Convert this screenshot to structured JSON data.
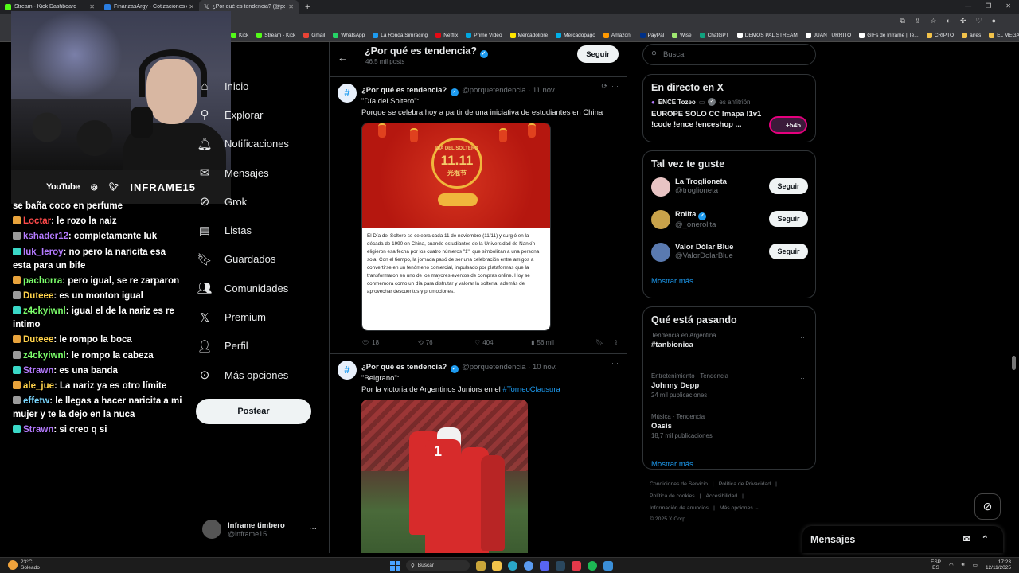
{
  "browser": {
    "tabs": [
      {
        "title": "Stream - Kick Dashboard",
        "color": "#53fc18"
      },
      {
        "title": "FinanzasArgy - Cotizaciones en ti",
        "color": "#2a7de1"
      },
      {
        "title": "¿Por qué es tendencia? (@porqu...",
        "color": "#ffffff"
      }
    ],
    "new_tab": "+",
    "bookmarks": [
      "Kick",
      "Stream - Kick",
      "Gmail",
      "WhatsApp",
      "La Ronda Simracing",
      "Netflix",
      "Prime Video",
      "Mercadolibre",
      "Mercadopago",
      "Amazon.",
      "PayPal",
      "Wise",
      "ChatGPT",
      "DEMOS PAL STREAM",
      "JUAN TURRITO",
      "GIFs de Inframe | Te...",
      "CRIPTO",
      "aires",
      "EL MEGA PACK PAP..."
    ]
  },
  "stream": {
    "yt": "YouTube",
    "handle": "INFRAME15",
    "chat": [
      {
        "user": "",
        "text": "se baña coco en perfume",
        "color": "#ffffff"
      },
      {
        "user": "Loctar",
        "text": ": le rozo la naiz",
        "color": "#ff4a4a"
      },
      {
        "user": "kshader12",
        "text": ": completamente luk",
        "color": "#b57bff"
      },
      {
        "user": "luk_leroy",
        "text": ": no pero la naricita esa esta para un bife",
        "color": "#b57bff"
      },
      {
        "user": "pachorra",
        "text": ": pero igual, se re zarparon",
        "color": "#7cff6b"
      },
      {
        "user": "Duteee",
        "text": ": es un monton igual",
        "color": "#ffd24a"
      },
      {
        "user": "z4ckyiwnl",
        "text": ": igual el de la nariz es re intimo",
        "color": "#7cff6b"
      },
      {
        "user": "Duteee",
        "text": ": le rompo la boca",
        "color": "#ffd24a"
      },
      {
        "user": "z4ckyiwnl",
        "text": ": le rompo la cabeza",
        "color": "#7cff6b"
      },
      {
        "user": "Strawn",
        "text": ": es una banda",
        "color": "#b57bff"
      },
      {
        "user": "ale_jue",
        "text": ": La nariz ya es otro límite",
        "color": "#ffd24a"
      },
      {
        "user": "effetw",
        "text": ": le llegas a hacer naricita a mi mujer y te la dejo en la nuca",
        "color": "#7ad7ff"
      },
      {
        "user": "Strawn",
        "text": ": si creo q si",
        "color": "#b57bff"
      }
    ]
  },
  "nav": {
    "items": [
      "Inicio",
      "Explorar",
      "Notificaciones",
      "Mensajes",
      "Grok",
      "Listas",
      "Guardados",
      "Comunidades",
      "Premium",
      "Perfil",
      "Más opciones"
    ],
    "post_button": "Postear",
    "account_name": "Inframe timbero",
    "account_handle": "@inframe15"
  },
  "header": {
    "title": "¿Por qué es tendencia?",
    "posts": "46,5 mil posts",
    "follow": "Seguir"
  },
  "posts": [
    {
      "name": "¿Por qué es tendencia?",
      "handle": "@porquetendencia · 11 nov.",
      "line1": "\"Día del Soltero\":",
      "line2": "Porque se celebra hoy a partir de una iniciativa de estudiantes en China",
      "medal_top": "DÍA DEL SOLTERO",
      "medal_num": "11.11",
      "medal_cn": "光棍节",
      "note": "El Día del Soltero se celebra cada 11 de noviembre (11/11) y surgió en la década de 1990 en China, cuando estudiantes de la Universidad de Nankín eligieron esa fecha por los cuatro números \"1\", que simbolizan a una persona sola. Con el tiempo, la jornada pasó de ser una celebración entre amigos a convertirse en un fenómeno comercial, impulsado por plataformas que la transformaron en uno de los mayores eventos de compras online. Hoy se conmemora como un día para disfrutar y valorar la soltería, además de aprovechar descuentos y promociones.",
      "replies": "18",
      "reposts": "76",
      "likes": "404",
      "views": "56 mil"
    },
    {
      "name": "¿Por qué es tendencia?",
      "handle": "@porquetendencia · 10 nov.",
      "line1": "\"Belgrano\":",
      "line2_pre": "Por la victoria de Argentinos Juniors en el ",
      "hashtag": "#TorneoClausura"
    }
  ],
  "right": {
    "search_placeholder": "Buscar",
    "live": {
      "title": "En directo en X",
      "host": "ENCE Tozeo",
      "host_role": "es anfitrión",
      "stream_title": "EUROPE SOLO CC !mapa !1v1 !code !ence !enceshop ...",
      "count": "+545"
    },
    "suggest": {
      "title": "Tal vez te guste",
      "users": [
        {
          "name": "La Troglioneta",
          "handle": "@troglioneta",
          "btn": "Seguir",
          "color": "#e8c4c4"
        },
        {
          "name": "Rolita",
          "handle": "@_onerolita",
          "btn": "Seguir",
          "color": "#c8a24a"
        },
        {
          "name": "Valor Dólar Blue",
          "handle": "@ValorDolarBlue",
          "btn": "Seguir",
          "color": "#5a7ab0"
        }
      ],
      "more": "Mostrar más"
    },
    "trends": {
      "title": "Qué está pasando",
      "items": [
        {
          "context": "Tendencia en Argentina",
          "name": "#tanbionica",
          "posts": ""
        },
        {
          "context": "Entretenimiento · Tendencia",
          "name": "Johnny Depp",
          "posts": "24 mil publicaciones"
        },
        {
          "context": "Música · Tendencia",
          "name": "Oasis",
          "posts": "18,7 mil publicaciones"
        }
      ],
      "more": "Mostrar más"
    },
    "footer": [
      "Condiciones de Servicio",
      "|",
      "Política de Privacidad",
      "|",
      "Política de cookies",
      "|",
      "Accesibilidad",
      "|",
      "Información de anuncios",
      "|",
      "Más opciones ···",
      "© 2025 X Corp."
    ],
    "messages": "Mensajes"
  },
  "taskbar": {
    "temp": "23°C",
    "weather": "Soleado",
    "search": "Buscar",
    "lang1": "ESP",
    "lang2": "ES",
    "time": "17:23",
    "date": "12/11/2025"
  }
}
